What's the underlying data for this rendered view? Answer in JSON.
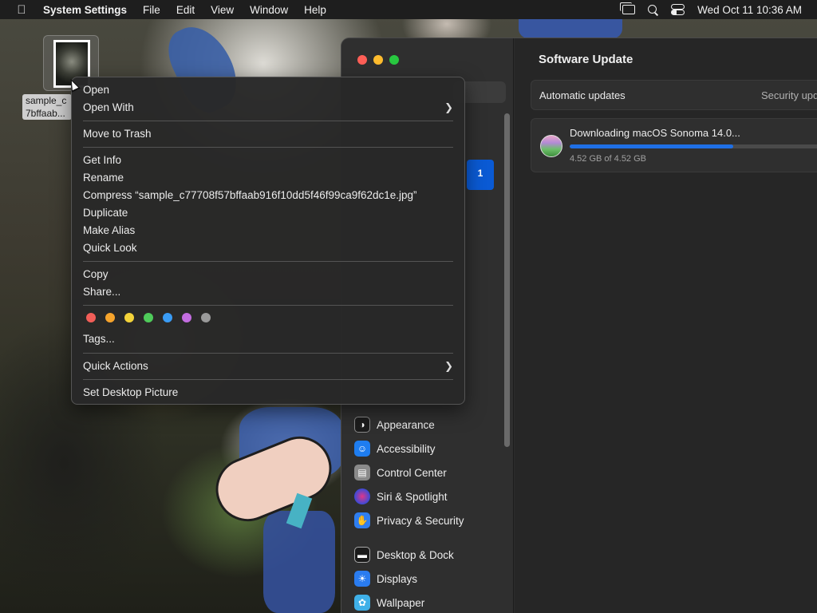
{
  "menubar": {
    "app_name": "System Settings",
    "menus": [
      "File",
      "Edit",
      "View",
      "Window",
      "Help"
    ],
    "datetime": "Wed Oct 11  10:36 AM"
  },
  "desktop": {
    "file_label_line1": "sample_c",
    "file_label_line2": "7bffaab..."
  },
  "context_menu": {
    "open": "Open",
    "open_with": "Open With",
    "move_to_trash": "Move to Trash",
    "get_info": "Get Info",
    "rename": "Rename",
    "compress": "Compress “sample_c77708f57bffaab916f10dd5f46f99ca9f62dc1e.jpg”",
    "duplicate": "Duplicate",
    "make_alias": "Make Alias",
    "quick_look": "Quick Look",
    "copy": "Copy",
    "share": "Share...",
    "tags": "Tags...",
    "quick_actions": "Quick Actions",
    "set_desktop_picture": "Set Desktop Picture",
    "tag_colors": [
      "#f25e58",
      "#f6a42c",
      "#f4d33a",
      "#4fcb5a",
      "#3a9cf5",
      "#c36de0",
      "#9a9a9a"
    ]
  },
  "settings": {
    "sidebar_badge": "1",
    "sidebar_items": [
      "Appearance",
      "Accessibility",
      "Control Center",
      "Siri & Spotlight",
      "Privacy & Security",
      "Desktop & Dock",
      "Displays",
      "Wallpaper"
    ],
    "title": "Software Update",
    "automatic_updates": "Automatic updates",
    "security_label": "Security upd",
    "download_title": "Downloading macOS Sonoma 14.0...",
    "download_size": "4.52 GB of 4.52 GB",
    "progress_fraction": 0.55
  }
}
